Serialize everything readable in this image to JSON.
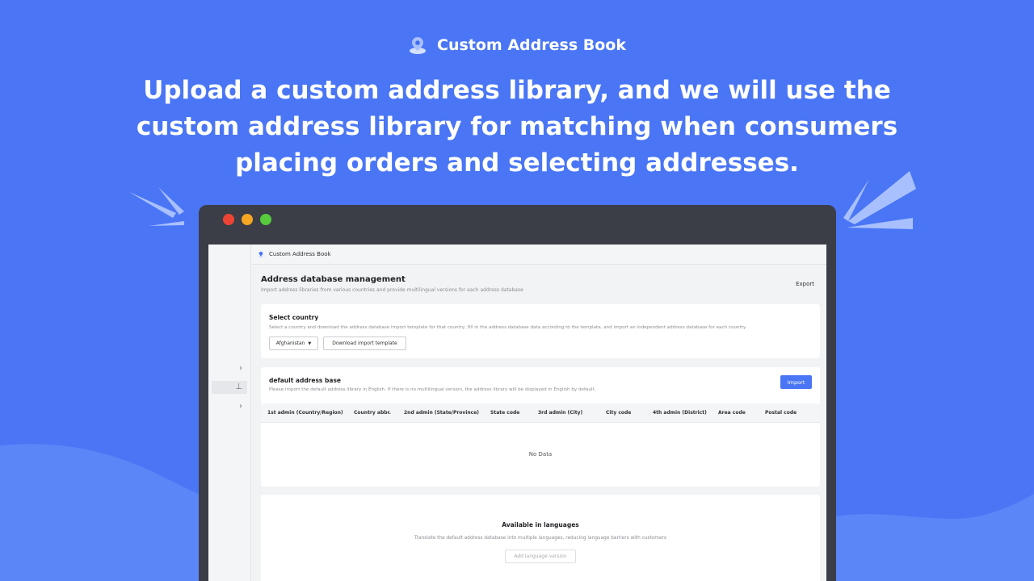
{
  "hero": {
    "brand_name": "Custom Address Book",
    "headline": "Upload a custom address library, and we will use the custom address library for matching when consumers placing orders and selecting addresses."
  },
  "colors": {
    "background": "#4a76f5",
    "window_frame": "#3b3d47",
    "primary_button": "#4a76f5"
  },
  "window": {
    "app_name": "Custom Address Book",
    "sidebar": {
      "items": [
        {
          "icon": "chevron-right-icon",
          "glyph": "›"
        },
        {
          "icon": "pin-icon",
          "glyph": "⊥"
        },
        {
          "icon": "chevron-right-icon",
          "glyph": "›"
        }
      ]
    },
    "header": {
      "title": "Address database management",
      "subtitle": "Import address libraries from various countries and provide multilingual versions for each address database",
      "export_label": "Export"
    },
    "select_country": {
      "title": "Select country",
      "description": "Select a country and download the address database import template for that country, fill in the address database data according to the template, and import an independent address database for each country",
      "selected_country": "Afghanistan",
      "download_label": "Download import template"
    },
    "default_base": {
      "title": "default address base",
      "description": "Please import the default address library in English. If there is no multilingual version, the address library will be displayed in English by default.",
      "import_label": "Import",
      "columns": [
        "1st admin (Country/Region)",
        "Country abbr.",
        "2nd admin (State/Province)",
        "State code",
        "3rd admin (City)",
        "City code",
        "4th admin (District)",
        "Area code",
        "Postal code"
      ],
      "empty_text": "No Data"
    },
    "languages": {
      "title": "Available in languages",
      "description": "Translate the default address database into multiple languages, reducing language barriers with customers",
      "add_label": "Add language version"
    }
  }
}
